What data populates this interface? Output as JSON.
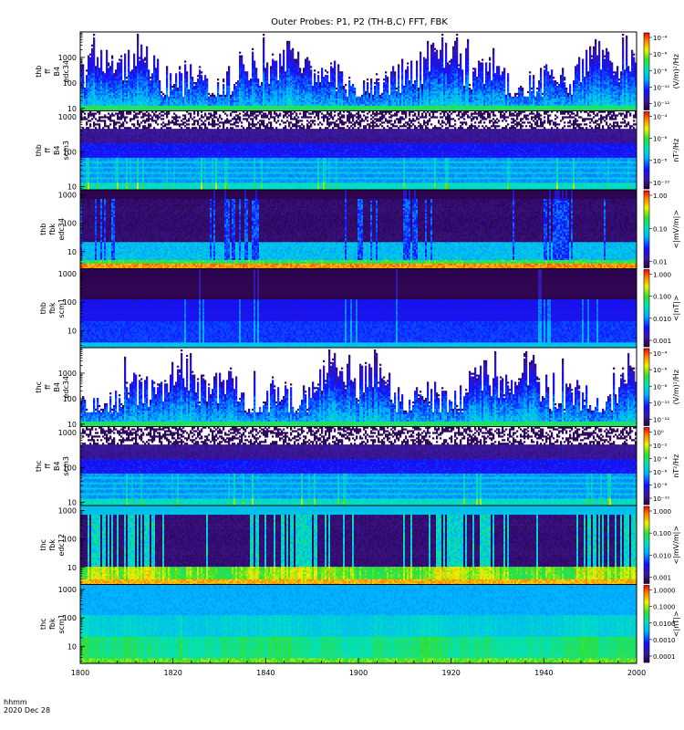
{
  "title": "Outer Probes: P1, P2 (TH-B,C) FFT, FBK",
  "footer": {
    "time_label": "hhmm",
    "date_label": "2020 Dec 28"
  },
  "chart_data": {
    "type": "heatmap",
    "x_ticks": [
      "1800",
      "1820",
      "1840",
      "1900",
      "1920",
      "1940",
      "2000"
    ],
    "x_range": [
      "1800",
      "2000"
    ],
    "y_scale": "log",
    "colormap": "rainbow (dark purple → blue → cyan → green → yellow → red)",
    "panels": [
      {
        "label_lines": [
          "thb",
          "ff",
          "B4",
          "edc34"
        ],
        "y_range": [
          8,
          10000
        ],
        "y_ticks": [
          "10",
          "100",
          "1000"
        ],
        "cbar_ticks": [
          "10⁻⁴",
          "10⁻⁶",
          "10⁻⁸",
          "10⁻¹⁰",
          "10⁻¹²"
        ],
        "cbar_label": "(V/m)²/Hz",
        "style": "spikes"
      },
      {
        "label_lines": [
          "thb",
          "ff",
          "B4",
          "scm3"
        ],
        "y_range": [
          8,
          1500
        ],
        "y_ticks": [
          "10",
          "100",
          "1000"
        ],
        "cbar_ticks": [
          "10⁻⁴",
          "10⁻⁶",
          "10⁻⁸",
          "10⁻¹⁰"
        ],
        "cbar_label": "nT²/Hz",
        "style": "scm-ff"
      },
      {
        "label_lines": [
          "thb",
          "fbk",
          "edc34"
        ],
        "y_range": [
          2.5,
          1500
        ],
        "y_ticks": [
          "10",
          "100",
          "1000"
        ],
        "cbar_ticks": [
          "1.00",
          "0.10",
          "0.01"
        ],
        "cbar_label": "<|mV/m|>",
        "style": "fbk-e"
      },
      {
        "label_lines": [
          "thb",
          "fbk",
          "scm1"
        ],
        "y_range": [
          2.5,
          1500
        ],
        "y_ticks": [
          "10",
          "100",
          "1000"
        ],
        "cbar_ticks": [
          "1.000",
          "0.100",
          "0.010",
          "0.001"
        ],
        "cbar_label": "<|nT|>",
        "style": "fbk-b"
      },
      {
        "label_lines": [
          "thc",
          "ff",
          "B4",
          "edc34"
        ],
        "y_range": [
          8,
          10000
        ],
        "y_ticks": [
          "10",
          "100",
          "1000"
        ],
        "cbar_ticks": [
          "10⁻⁴",
          "10⁻⁶",
          "10⁻⁸",
          "10⁻¹⁰",
          "10⁻¹²"
        ],
        "cbar_label": "(V/m)²/Hz",
        "style": "spikes"
      },
      {
        "label_lines": [
          "thc",
          "ff",
          "B4",
          "scm3"
        ],
        "y_range": [
          8,
          1500
        ],
        "y_ticks": [
          "10",
          "100",
          "1000"
        ],
        "cbar_ticks": [
          "10⁰",
          "10⁻²",
          "10⁻⁴",
          "10⁻⁶",
          "10⁻⁸",
          "10⁻¹⁰"
        ],
        "cbar_label": "nT²/Hz",
        "style": "scm-ff"
      },
      {
        "label_lines": [
          "thc",
          "fbk",
          "edc12"
        ],
        "y_range": [
          2.5,
          1500
        ],
        "y_ticks": [
          "10",
          "100",
          "1000"
        ],
        "cbar_ticks": [
          "1.000",
          "0.100",
          "0.010",
          "0.001"
        ],
        "cbar_label": "<|mV/m|>",
        "style": "fbk-e2"
      },
      {
        "label_lines": [
          "thc",
          "fbk",
          "scm1"
        ],
        "y_range": [
          2.5,
          1500
        ],
        "y_ticks": [
          "10",
          "100",
          "1000"
        ],
        "cbar_ticks": [
          "1.0000",
          "0.1000",
          "0.0100",
          "0.0010",
          "0.0001"
        ],
        "cbar_label": "<|nT|>",
        "style": "fbk-b2"
      }
    ]
  }
}
